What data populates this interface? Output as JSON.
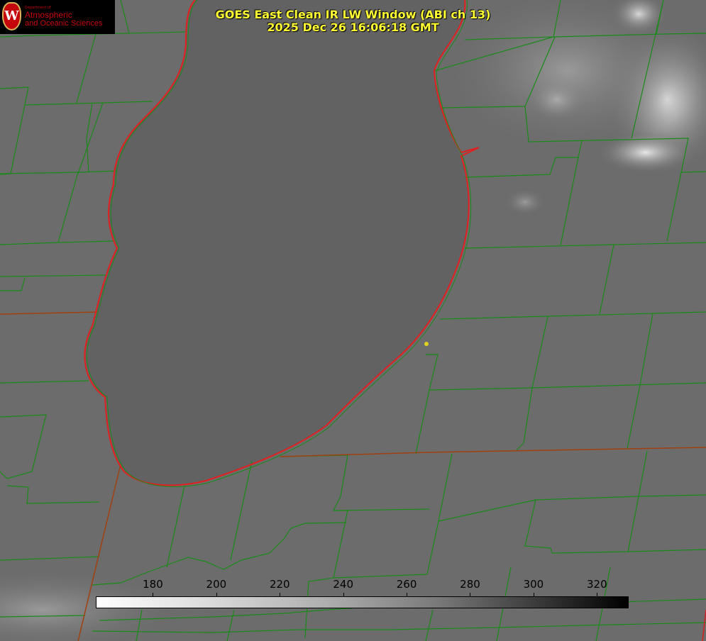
{
  "title": {
    "line1": "GOES East Clean IR LW Window (ABI ch 13)",
    "line2": "2025 Dec 26 16:06:18 GMT"
  },
  "logo": {
    "dept": "Department of",
    "line1": "Atmospheric",
    "line2": "and Oceanic Sciences",
    "mark": "W"
  },
  "colorbar": {
    "min": 162,
    "max": 330,
    "ticks": [
      "180",
      "200",
      "220",
      "240",
      "260",
      "280",
      "300",
      "320"
    ],
    "tick_values": [
      180,
      200,
      220,
      240,
      260,
      280,
      300,
      320
    ]
  },
  "colors": {
    "title": "#ffff33",
    "county_lines": "#1a8a1a",
    "state_lines": "#e02020",
    "marker": "#e0d020"
  }
}
